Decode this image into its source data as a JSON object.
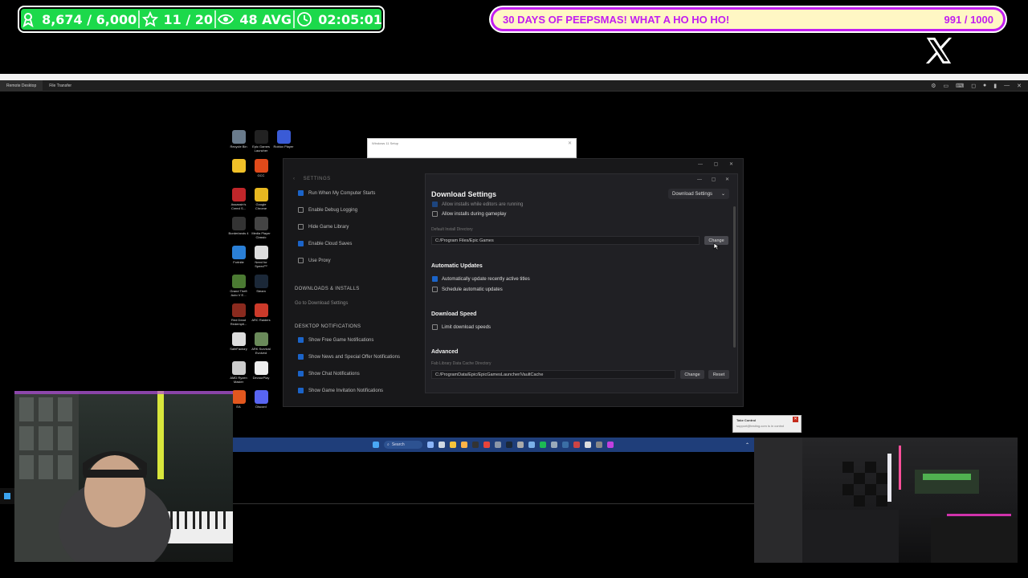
{
  "overlay": {
    "stats": {
      "followers": "8,674 / 6,000",
      "subs": "11 / 20",
      "viewers": "48 AVG",
      "uptime": "02:05:01"
    },
    "goal": {
      "label": "30 DAYS OF PEEPSMAS! WHAT A HO HO HO!",
      "progress": "991 / 1000",
      "progress_value": 991,
      "progress_max": 1000
    },
    "social_icon": "x-logo-icon"
  },
  "remote_desktop": {
    "tabs": [
      "Remote Desktop",
      "File Transfer"
    ]
  },
  "desktop_icons": [
    {
      "label": "Recycle Bin",
      "color": "#6a7b8c"
    },
    {
      "label": "Epic Games Launcher",
      "color": "#222222"
    },
    {
      "label": "Roblox Player",
      "color": "#3a5bd6"
    },
    {
      "label": "",
      "color": "#f0c028"
    },
    {
      "label": "GCC",
      "color": "#e04a1a"
    },
    {
      "label": "Assassin's Creed S...",
      "color": "#c0262a"
    },
    {
      "label": "Google Chrome",
      "color": "#e8b820"
    },
    {
      "label": "Borderlands 4",
      "color": "#333333"
    },
    {
      "label": "Media Player Classic",
      "color": "#444444"
    },
    {
      "label": "Fortnite",
      "color": "#2a7fd6"
    },
    {
      "label": "Need for Speed™",
      "color": "#dddddd"
    },
    {
      "label": "Grand Theft Auto V E...",
      "color": "#4b7a32"
    },
    {
      "label": "Steam",
      "color": "#1b2838"
    },
    {
      "label": "Red Dead Redempti...",
      "color": "#8a2a1e"
    },
    {
      "label": "ARC Raiders",
      "color": "#cc3a2a"
    },
    {
      "label": "SafeFactory",
      "color": "#dddddd"
    },
    {
      "label": "ARK Survival Evolved",
      "color": "#6a8a5a"
    },
    {
      "label": "AMD Ryzen Master",
      "color": "#cccccc"
    },
    {
      "label": "DevourPlay",
      "color": "#eeeeee"
    },
    {
      "label": "EA",
      "color": "#e2571e"
    },
    {
      "label": "Discord",
      "color": "#5865f2"
    }
  ],
  "setup_window": {
    "title": "Windows 11 Setup"
  },
  "settings": {
    "breadcrumb": "SETTINGS",
    "left_options": [
      {
        "label": "Run When My Computer Starts",
        "checked": true
      },
      {
        "label": "Enable Debug Logging",
        "checked": false
      },
      {
        "label": "Hide Game Library",
        "checked": false
      },
      {
        "label": "Enable Cloud Saves",
        "checked": true
      },
      {
        "label": "Use Proxy",
        "checked": false
      }
    ],
    "downloads_header": "DOWNLOADS & INSTALLS",
    "downloads_link": "Go to Download Settings",
    "notifications_header": "DESKTOP NOTIFICATIONS",
    "notification_options": [
      {
        "label": "Show Free Game Notifications",
        "checked": true
      },
      {
        "label": "Show News and Special Offer Notifications",
        "checked": true
      },
      {
        "label": "Show Chat Notifications",
        "checked": true
      },
      {
        "label": "Show Game Invitation Notifications",
        "checked": true
      }
    ]
  },
  "download_settings": {
    "title": "Download Settings",
    "dropdown": "Download Settings",
    "partial_option": "Allow installs while editors are running",
    "allow_gameplay": "Allow installs during gameplay",
    "default_dir_label": "Default Install Directory",
    "default_dir_value": "C:/Program Files/Epic Games",
    "change_label": "Change",
    "auto_updates_head": "Automatic Updates",
    "auto_update_recent": "Automatically update recently active titles",
    "schedule_updates": "Schedule automatic updates",
    "speed_head": "Download Speed",
    "limit_speeds": "Limit download speeds",
    "advanced_head": "Advanced",
    "cache_label": "Fab Library Data Cache Directory",
    "cache_value": "C:/ProgramData/Epic/EpicGamesLauncher/VaultCache",
    "reset_label": "Reset"
  },
  "toast": {
    "title": "Take Control",
    "body": "support@testing.com is in control"
  },
  "taskbar": {
    "search": "Search"
  },
  "colors": {
    "stats_green": "#1cd94b",
    "goal_magenta": "#c21ef0",
    "goal_fill": "#fff7c4",
    "checkbox_blue": "#1b64c9",
    "taskbar_blue": "#1f3e7a"
  }
}
